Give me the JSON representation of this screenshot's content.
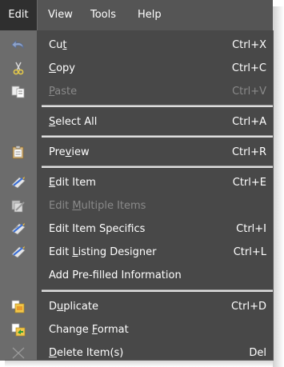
{
  "menubar": {
    "items": [
      {
        "label": "Edit"
      },
      {
        "label": "View"
      },
      {
        "label": "Tools"
      },
      {
        "label": "Help"
      }
    ]
  },
  "menu": {
    "groups": [
      [
        {
          "label": "Cut",
          "mnemonic": "t",
          "shortcut": "Ctrl+X",
          "icon": "undo-arrow-icon",
          "enabled": true
        },
        {
          "label": "Copy",
          "mnemonic": "C",
          "shortcut": "Ctrl+C",
          "icon": "scissors-icon",
          "enabled": true
        },
        {
          "label": "Paste",
          "mnemonic": "P",
          "shortcut": "Ctrl+V",
          "icon": "copy-pages-icon",
          "enabled": false
        }
      ],
      [
        {
          "label": "Select All",
          "mnemonic": "S",
          "shortcut": "Ctrl+A",
          "icon": "",
          "enabled": true
        }
      ],
      [
        {
          "label": "Preview",
          "mnemonic": "v",
          "shortcut": "Ctrl+R",
          "icon": "clipboard-icon",
          "enabled": true
        }
      ],
      [
        {
          "label": "Edit Item",
          "mnemonic": "E",
          "shortcut": "Ctrl+E",
          "icon": "edit-pen-icon",
          "enabled": true
        },
        {
          "label": "Edit Multiple Items",
          "mnemonic": "M",
          "shortcut": "",
          "icon": "multi-edit-icon",
          "enabled": false
        },
        {
          "label": "Edit Item Specifics",
          "mnemonic": "",
          "shortcut": "Ctrl+I",
          "icon": "specifics-edit-icon",
          "enabled": true
        },
        {
          "label": "Edit Listing Designer",
          "mnemonic": "L",
          "shortcut": "Ctrl+L",
          "icon": "designer-edit-icon",
          "enabled": true
        },
        {
          "label": "Add Pre-filled Information",
          "mnemonic": "",
          "shortcut": "",
          "icon": "",
          "enabled": true
        }
      ],
      [
        {
          "label": "Duplicate",
          "mnemonic": "u",
          "shortcut": "Ctrl+D",
          "icon": "duplicate-icon",
          "enabled": true
        },
        {
          "label": "Change Format",
          "mnemonic": "F",
          "shortcut": "",
          "icon": "change-format-icon",
          "enabled": true
        },
        {
          "label": "Delete Item(s)",
          "mnemonic": "D",
          "shortcut": "Del",
          "icon": "delete-x-icon",
          "enabled": true
        }
      ]
    ]
  }
}
